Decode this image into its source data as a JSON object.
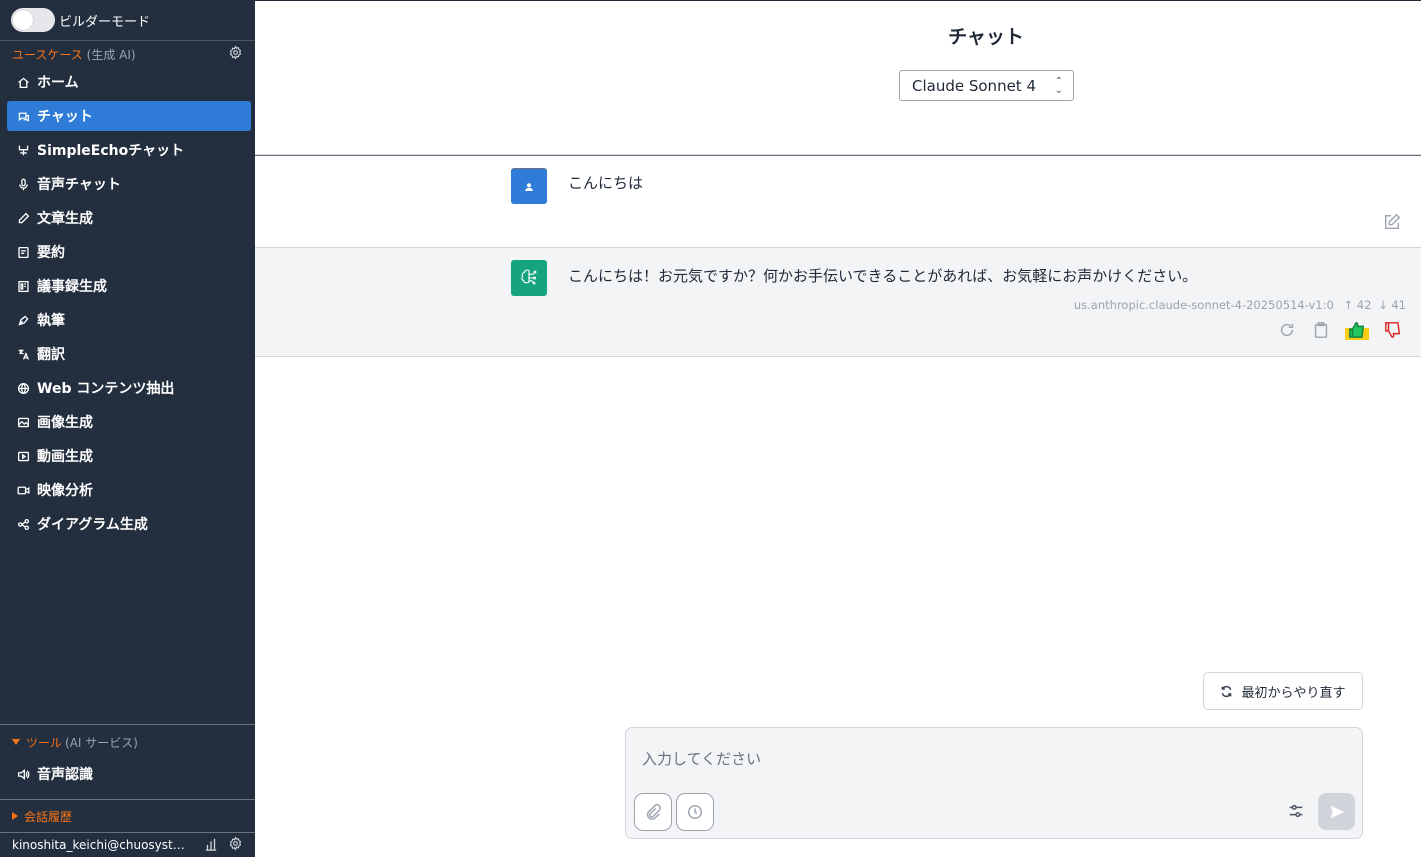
{
  "builder": {
    "label": "ビルダーモード",
    "enabled": false
  },
  "sidebar": {
    "usecases_title": "ユースケース",
    "usecases_sub": "(生成 AI)",
    "items": [
      {
        "label": "ホーム",
        "icon": "home-icon"
      },
      {
        "label": "チャット",
        "icon": "chat-icon",
        "active": true
      },
      {
        "label": "SimpleEchoチャット",
        "icon": "echo-icon"
      },
      {
        "label": "音声チャット",
        "icon": "mic-icon"
      },
      {
        "label": "文章生成",
        "icon": "pencil-icon"
      },
      {
        "label": "要約",
        "icon": "summary-icon"
      },
      {
        "label": "議事録生成",
        "icon": "minutes-icon"
      },
      {
        "label": "執筆",
        "icon": "pen-nib-icon"
      },
      {
        "label": "翻訳",
        "icon": "translate-icon"
      },
      {
        "label": "Web コンテンツ抽出",
        "icon": "globe-icon"
      },
      {
        "label": "画像生成",
        "icon": "image-icon"
      },
      {
        "label": "動画生成",
        "icon": "video-play-icon"
      },
      {
        "label": "映像分析",
        "icon": "camera-icon"
      },
      {
        "label": "ダイアグラム生成",
        "icon": "diagram-icon"
      }
    ],
    "tools_title": "ツール",
    "tools_sub": "(AI サービス)",
    "tools_items": [
      {
        "label": "音声認識",
        "icon": "speaker-icon"
      }
    ],
    "history_label": "会話履歴",
    "user_email": "kinoshita_keichi@chuosystem.co.jp"
  },
  "main": {
    "title": "チャット",
    "model": "Claude Sonnet 4",
    "messages": [
      {
        "role": "user",
        "text": "こんにちは"
      },
      {
        "role": "assistant",
        "text": "こんにちは！お元気ですか？何かお手伝いできることがあれば、お気軽にお声かけください。",
        "model_id": "us.anthropic.claude-sonnet-4-20250514-v1:0",
        "tokens_in": "↑ 42",
        "tokens_out": "↓ 41"
      }
    ],
    "restart_label": "最初からやり直す",
    "input_placeholder": "入力してください"
  },
  "colors": {
    "sidebar_bg": "#232f3e",
    "active_bg": "#2e7bd8",
    "accent_orange": "#f97316",
    "bot_avatar": "#16a37f",
    "thumb_up_highlight": "#facc15",
    "thumb_up_icon": "#16a34a",
    "thumb_down_icon": "#dc2626"
  }
}
